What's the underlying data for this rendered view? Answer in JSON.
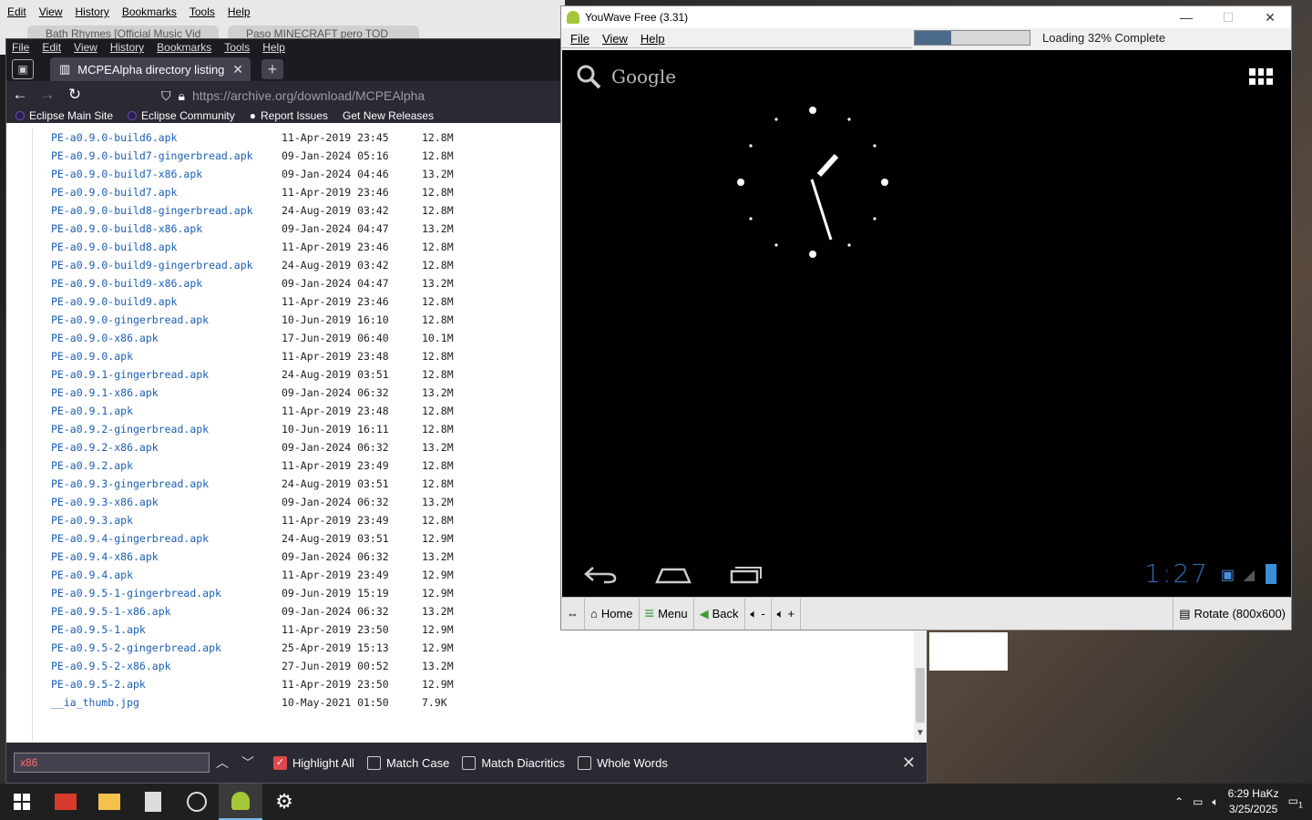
{
  "back_browser": {
    "menu": [
      "Edit",
      "View",
      "History",
      "Bookmarks",
      "Tools",
      "Help"
    ],
    "tabs": [
      "Bath Rhymes [Official Music Vid",
      "Paso MINECRAFT pero TOD"
    ]
  },
  "browser": {
    "menu": [
      "File",
      "Edit",
      "View",
      "History",
      "Bookmarks",
      "Tools",
      "Help"
    ],
    "active_tab": "MCPEAlpha directory listing",
    "url_prefix": "https://archive.org",
    "url_path": "/download/MCPEAlpha",
    "bookmarks": [
      "Eclipse Main Site",
      "Eclipse Community",
      "Report Issues",
      "Get New Releases"
    ],
    "files": [
      {
        "name": "PE-a0.9.0-build6.apk",
        "date": "11-Apr-2019 23:45",
        "size": "12.8M"
      },
      {
        "name": "PE-a0.9.0-build7-gingerbread.apk",
        "date": "09-Jan-2024 05:16",
        "size": "12.8M"
      },
      {
        "name": "PE-a0.9.0-build7-x86.apk",
        "date": "09-Jan-2024 04:46",
        "size": "13.2M"
      },
      {
        "name": "PE-a0.9.0-build7.apk",
        "date": "11-Apr-2019 23:46",
        "size": "12.8M"
      },
      {
        "name": "PE-a0.9.0-build8-gingerbread.apk",
        "date": "24-Aug-2019 03:42",
        "size": "12.8M"
      },
      {
        "name": "PE-a0.9.0-build8-x86.apk",
        "date": "09-Jan-2024 04:47",
        "size": "13.2M"
      },
      {
        "name": "PE-a0.9.0-build8.apk",
        "date": "11-Apr-2019 23:46",
        "size": "12.8M"
      },
      {
        "name": "PE-a0.9.0-build9-gingerbread.apk",
        "date": "24-Aug-2019 03:42",
        "size": "12.8M"
      },
      {
        "name": "PE-a0.9.0-build9-x86.apk",
        "date": "09-Jan-2024 04:47",
        "size": "13.2M"
      },
      {
        "name": "PE-a0.9.0-build9.apk",
        "date": "11-Apr-2019 23:46",
        "size": "12.8M"
      },
      {
        "name": "PE-a0.9.0-gingerbread.apk",
        "date": "10-Jun-2019 16:10",
        "size": "12.8M"
      },
      {
        "name": "PE-a0.9.0-x86.apk",
        "date": "17-Jun-2019 06:40",
        "size": "10.1M"
      },
      {
        "name": "PE-a0.9.0.apk",
        "date": "11-Apr-2019 23:48",
        "size": "12.8M"
      },
      {
        "name": "PE-a0.9.1-gingerbread.apk",
        "date": "24-Aug-2019 03:51",
        "size": "12.8M"
      },
      {
        "name": "PE-a0.9.1-x86.apk",
        "date": "09-Jan-2024 06:32",
        "size": "13.2M"
      },
      {
        "name": "PE-a0.9.1.apk",
        "date": "11-Apr-2019 23:48",
        "size": "12.8M"
      },
      {
        "name": "PE-a0.9.2-gingerbread.apk",
        "date": "10-Jun-2019 16:11",
        "size": "12.8M"
      },
      {
        "name": "PE-a0.9.2-x86.apk",
        "date": "09-Jan-2024 06:32",
        "size": "13.2M"
      },
      {
        "name": "PE-a0.9.2.apk",
        "date": "11-Apr-2019 23:49",
        "size": "12.8M"
      },
      {
        "name": "PE-a0.9.3-gingerbread.apk",
        "date": "24-Aug-2019 03:51",
        "size": "12.8M"
      },
      {
        "name": "PE-a0.9.3-x86.apk",
        "date": "09-Jan-2024 06:32",
        "size": "13.2M"
      },
      {
        "name": "PE-a0.9.3.apk",
        "date": "11-Apr-2019 23:49",
        "size": "12.8M"
      },
      {
        "name": "PE-a0.9.4-gingerbread.apk",
        "date": "24-Aug-2019 03:51",
        "size": "12.9M"
      },
      {
        "name": "PE-a0.9.4-x86.apk",
        "date": "09-Jan-2024 06:32",
        "size": "13.2M"
      },
      {
        "name": "PE-a0.9.4.apk",
        "date": "11-Apr-2019 23:49",
        "size": "12.9M"
      },
      {
        "name": "PE-a0.9.5-1-gingerbread.apk",
        "date": "09-Jun-2019 15:19",
        "size": "12.9M"
      },
      {
        "name": "PE-a0.9.5-1-x86.apk",
        "date": "09-Jan-2024 06:32",
        "size": "13.2M"
      },
      {
        "name": "PE-a0.9.5-1.apk",
        "date": "11-Apr-2019 23:50",
        "size": "12.9M"
      },
      {
        "name": "PE-a0.9.5-2-gingerbread.apk",
        "date": "25-Apr-2019 15:13",
        "size": "12.9M"
      },
      {
        "name": "PE-a0.9.5-2-x86.apk",
        "date": "27-Jun-2019 00:52",
        "size": "13.2M"
      },
      {
        "name": "PE-a0.9.5-2.apk",
        "date": "11-Apr-2019 23:50",
        "size": "12.9M"
      },
      {
        "name": "__ia_thumb.jpg",
        "date": "10-May-2021 01:50",
        "size": "7.9K"
      }
    ],
    "findbar": {
      "value": "x86",
      "options": [
        {
          "label": "Highlight All",
          "checked": true
        },
        {
          "label": "Match Case",
          "checked": false
        },
        {
          "label": "Match Diacritics",
          "checked": false
        },
        {
          "label": "Whole Words",
          "checked": false
        }
      ]
    }
  },
  "youwave": {
    "title": "YouWave Free (3.31)",
    "menu": [
      "File",
      "View",
      "Help"
    ],
    "progress_fraction": 0.32,
    "status": "Loading 32% Complete",
    "search_label": "Google",
    "android_time": "1:27",
    "toolbar": {
      "home": "Home",
      "menu": "Menu",
      "back": "Back",
      "vol_down": "-",
      "vol_up": "+",
      "rotate": "Rotate (800x600)"
    }
  },
  "taskbar": {
    "time": "6:29 HaKz",
    "date": "3/25/2025",
    "notification_count": "1"
  },
  "colors": {
    "link": "#1a5fb4",
    "firefox_dark": "#2b2a33",
    "highlight_check": "#e0474c",
    "android_clock": "#2e6fb0"
  }
}
